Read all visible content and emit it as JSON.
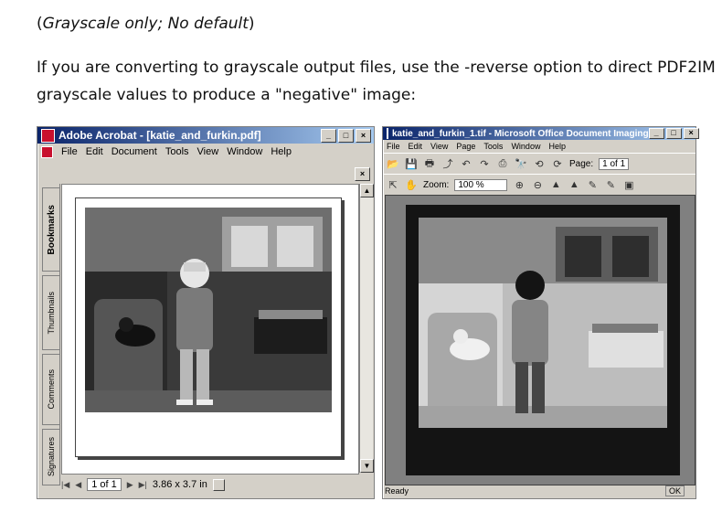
{
  "doc": {
    "line1_part1": "(",
    "line1_italic": "Grayscale only; No default",
    "line1_part2": ")",
    "line2": "If you are converting to grayscale output files, use the -reverse option to direct PDF2IM",
    "line3": "grayscale values to produce a \"negative\" image:"
  },
  "acrobat": {
    "title": "Adobe Acrobat - [katie_and_furkin.pdf]",
    "menu": [
      "File",
      "Edit",
      "Document",
      "Tools",
      "View",
      "Window",
      "Help"
    ],
    "tabs": [
      "Bookmarks",
      "Thumbnails",
      "Comments",
      "Signatures"
    ],
    "page_indicator": "1 of 1",
    "page_size": "3.86 x 3.7 in"
  },
  "imaging": {
    "title": "katie_and_furkin_1.tif - Microsoft Office Document Imaging",
    "menu": [
      "File",
      "Edit",
      "View",
      "Page",
      "Tools",
      "Window",
      "Help"
    ],
    "page_label": "Page:",
    "page_value": "1 of 1",
    "zoom_label": "Zoom:",
    "zoom_value": "100 %",
    "status": "Ready",
    "status_right": "OK"
  },
  "colors": {
    "titlebar_start": "#0a246a",
    "titlebar_end": "#a6caf0",
    "chrome": "#d4d0c8"
  }
}
